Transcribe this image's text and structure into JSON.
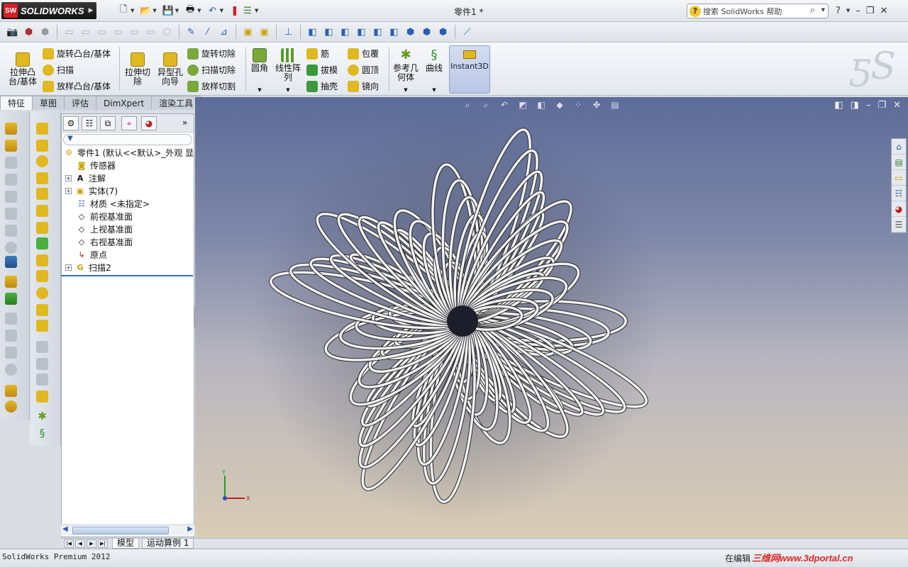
{
  "app": {
    "brand": "SOLIDWORKS",
    "document_title": "零件1 *",
    "search_placeholder": "搜索 SolidWorks 帮助"
  },
  "ribbon": {
    "revolve_boss": "旋转凸台/基体",
    "sweep_boss": "扫描",
    "loft_boss": "放样凸台/基体",
    "extrude_boss_line1": "拉伸凸",
    "extrude_boss_line2": "台/基体",
    "extrude_cut_line1": "拉伸切",
    "extrude_cut_line2": "除",
    "hole_wizard_line1": "异型孔",
    "hole_wizard_line2": "向导",
    "revolve_cut": "旋转切除",
    "sweep_cut": "扫描切除",
    "loft_cut": "放样切割",
    "fillet": "圆角",
    "linear_pattern_line1": "线性阵",
    "linear_pattern_line2": "列",
    "rib": "筋",
    "draft": "拔模",
    "shell": "抽壳",
    "wrap": "包覆",
    "dome": "圆顶",
    "mirror": "镜向",
    "ref_geometry_line1": "参考几",
    "ref_geometry_line2": "何体",
    "curves": "曲线",
    "instant3d": "Instant3D"
  },
  "command_tabs": [
    "特征",
    "草图",
    "评估",
    "DimXpert",
    "渲染工具"
  ],
  "tree": {
    "root": "零件1  (默认<<默认>_外观 显",
    "items": [
      {
        "label": "传感器",
        "icon": "sensor-icon"
      },
      {
        "label": "注解",
        "icon": "annotation-icon"
      },
      {
        "label": "实体(7)",
        "icon": "solid-bodies-icon"
      },
      {
        "label": "材质 <未指定>",
        "icon": "material-icon"
      },
      {
        "label": "前视基准面",
        "icon": "plane-icon"
      },
      {
        "label": "上视基准面",
        "icon": "plane-icon"
      },
      {
        "label": "右视基准面",
        "icon": "plane-icon"
      },
      {
        "label": "原点",
        "icon": "origin-icon"
      },
      {
        "label": "扫描2",
        "icon": "sweep-feature-icon"
      }
    ]
  },
  "bottom_tabs": [
    "模型",
    "运动算例 1"
  ],
  "status": {
    "product": "SolidWorks Premium 2012",
    "mode": "在编辑",
    "watermark": "三维网www.3dportal.cn"
  },
  "triad": {
    "y": "Y",
    "x": "X"
  },
  "colors": {
    "viewport_top": "#5c6c98",
    "viewport_bottom": "#d9ccb5",
    "accent": "#2f6fc4"
  }
}
